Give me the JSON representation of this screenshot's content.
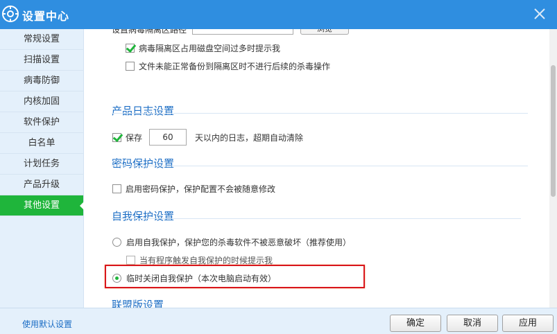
{
  "window": {
    "title": "设置中心",
    "close_icon": "close-icon",
    "logo_icon": "gear-logo-icon"
  },
  "sidebar": {
    "items": [
      {
        "label": "常规设置"
      },
      {
        "label": "扫描设置"
      },
      {
        "label": "病毒防御"
      },
      {
        "label": "内核加固"
      },
      {
        "label": "软件保护"
      },
      {
        "label": "白名单"
      },
      {
        "label": "计划任务"
      },
      {
        "label": "产品升级"
      },
      {
        "label": "其他设置",
        "active": true
      }
    ]
  },
  "quarantine": {
    "path_label_partial": "设置病毒隔离区路径",
    "browse_label": "浏览",
    "option_space_warn": {
      "label": "病毒隔离区占用磁盘空间过多时提示我",
      "checked": true
    },
    "option_backup_fail": {
      "label": "文件未能正常备份到隔离区时不进行后续的杀毒操作",
      "checked": false
    }
  },
  "log": {
    "title": "产品日志设置",
    "save_label": "保存",
    "save_checked": true,
    "days_value": "60",
    "days_suffix": "天以内的日志，超期自动清除"
  },
  "password": {
    "title": "密码保护设置",
    "enable_label": "启用密码保护，保护配置不会被随意修改",
    "enable_checked": false
  },
  "self_protect": {
    "title": "自我保护设置",
    "enable_label": "启用自我保护，保护您的杀毒软件不被恶意破坏（推荐使用）",
    "enable_selected": false,
    "notify_label": "当有程序触发自我保护的时候提示我",
    "notify_checked": false,
    "temp_off_label": "临时关闭自我保护（本次电脑启动有效）",
    "temp_off_selected": true
  },
  "union": {
    "title_partial": "联盟版设置"
  },
  "footer": {
    "default_link": "使用默认设置",
    "ok_label": "确定",
    "cancel_label": "取消",
    "apply_label": "应用"
  },
  "colors": {
    "title_bar": "#2f8ee0",
    "active_green": "#1fb53b",
    "highlight_red": "#d9161c",
    "section_blue": "#1a6cc4"
  }
}
